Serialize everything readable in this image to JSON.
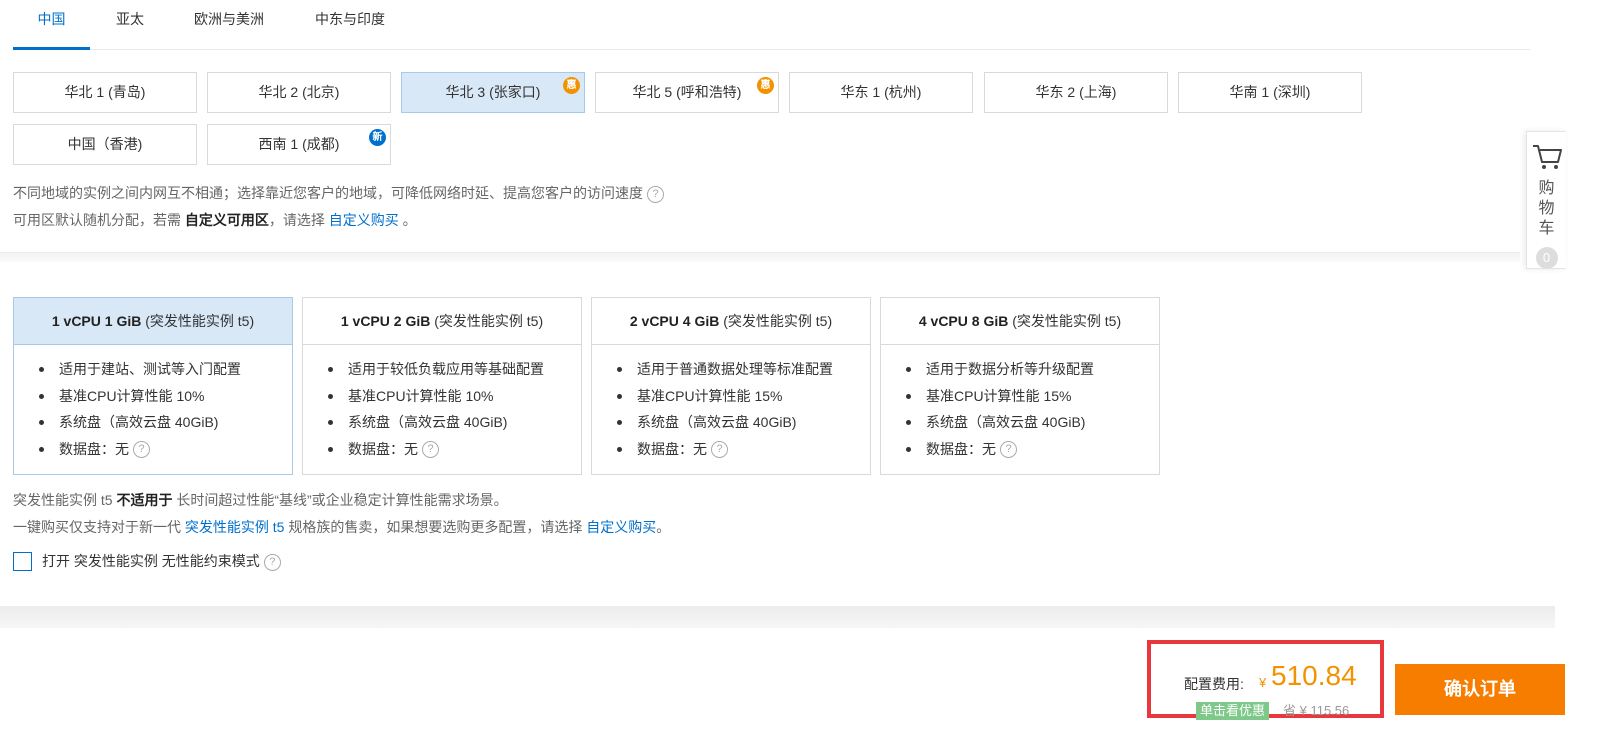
{
  "region_tabs": [
    "中国",
    "亚太",
    "欧洲与美洲",
    "中东与印度"
  ],
  "zones": [
    {
      "label": "华北 1 (青岛)"
    },
    {
      "label": "华北 2 (北京)"
    },
    {
      "label": "华北 3 (张家口)",
      "badge": "惠"
    },
    {
      "label": "华北 5 (呼和浩特)",
      "badge": "惠"
    },
    {
      "label": "华东 1 (杭州)"
    },
    {
      "label": "华东 2 (上海)"
    },
    {
      "label": "华南 1 (深圳)"
    },
    {
      "label": "中国（香港)"
    },
    {
      "label": "西南 1 (成都)",
      "badge": "新"
    }
  ],
  "selected_zone": "华北 3 (张家口)",
  "region_note": "不同地域的实例之间内网互不相通；选择靠近您客户的地域，可降低网络时延、提高您客户的访问速度",
  "zone_note": {
    "prefix": "可用区默认随机分配，若需 ",
    "bold": "自定义可用区",
    "middle": "，请选择 ",
    "link": "自定义购买",
    "suffix": " 。"
  },
  "help_symbol": "?",
  "instances": [
    {
      "spec": "1 vCPU 1 GiB",
      "family": " (突发性能实例 t5)",
      "features": [
        "适用于建站、测试等入门配置",
        "基准CPU计算性能 10%",
        "系统盘（高效云盘 40GiB)",
        "数据盘：无"
      ]
    },
    {
      "spec": "1 vCPU 2 GiB",
      "family": " (突发性能实例 t5)",
      "features": [
        "适用于较低负载应用等基础配置",
        "基准CPU计算性能 10%",
        "系统盘（高效云盘 40GiB)",
        "数据盘：无"
      ]
    },
    {
      "spec": "2 vCPU 4 GiB",
      "family": " (突发性能实例 t5)",
      "features": [
        "适用于普通数据处理等标准配置",
        "基准CPU计算性能 15%",
        "系统盘（高效云盘 40GiB)",
        "数据盘：无"
      ]
    },
    {
      "spec": "4 vCPU 8 GiB",
      "family": " (突发性能实例 t5)",
      "features": [
        "适用于数据分析等升级配置",
        "基准CPU计算性能 15%",
        "系统盘（高效云盘 40GiB)",
        "数据盘：无"
      ]
    }
  ],
  "selected_instance": "1 vCPU 1 GiB",
  "t5_note": {
    "prefix": "突发性能实例 t5 ",
    "bold": "不适用于",
    "suffix": " 长时间超过性能“基线”或企业稳定计算性能需求场景。"
  },
  "buy_note": {
    "prefix": "一键购买仅支持对于新一代 ",
    "link1": "突发性能实例 t5",
    "middle": " 规格族的售卖，如果想要选购更多配置，请选择 ",
    "link2": "自定义购买",
    "suffix": "。"
  },
  "unlimited_mode": {
    "label": "打开 突发性能实例 无性能约束模式",
    "checked": false
  },
  "cart": {
    "label_chars": [
      "购",
      "物",
      "车"
    ],
    "count": "0"
  },
  "price": {
    "label": "配置费用:",
    "currency": "¥",
    "value": "510.84",
    "promo": "单击看优惠",
    "saving": "省 ¥ 115.56"
  },
  "confirm_label": "确认订单",
  "colors": {
    "accent": "#0070cc",
    "price": "#f39200",
    "confirm": "#f77d00",
    "highlight_border": "#e8373d"
  }
}
